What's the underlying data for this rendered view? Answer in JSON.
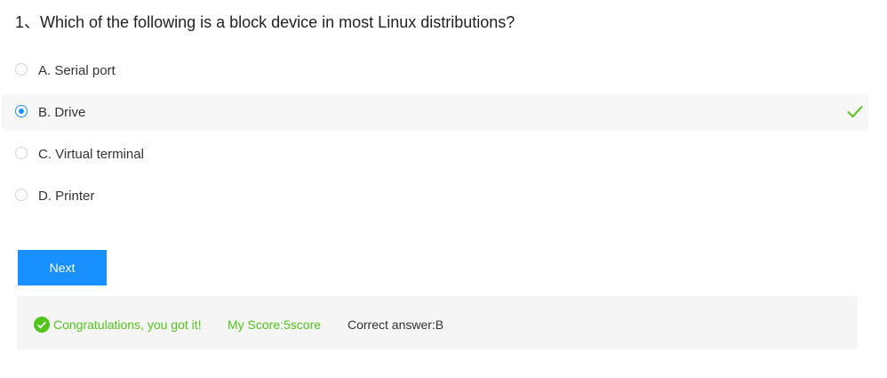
{
  "question": {
    "text": "1、Which of the following is a block device in most Linux distributions?"
  },
  "options": [
    {
      "label": "A. Serial port",
      "selected": false
    },
    {
      "label": "B. Drive",
      "selected": true,
      "marked_correct": true
    },
    {
      "label": "C. Virtual terminal",
      "selected": false
    },
    {
      "label": "D. Printer",
      "selected": false
    }
  ],
  "next_button": {
    "label": "Next"
  },
  "result": {
    "message": "Congratulations, you got it!",
    "score": "My Score:5score",
    "correct_answer": "Correct answer:B"
  },
  "colors": {
    "accent": "#1890ff",
    "success": "#52c41a",
    "selected_row_bg": "#f7f7f7",
    "result_bg": "#f5f5f5"
  },
  "icons": {
    "selected_check": "check-icon",
    "result_status": "check-circle-icon"
  }
}
